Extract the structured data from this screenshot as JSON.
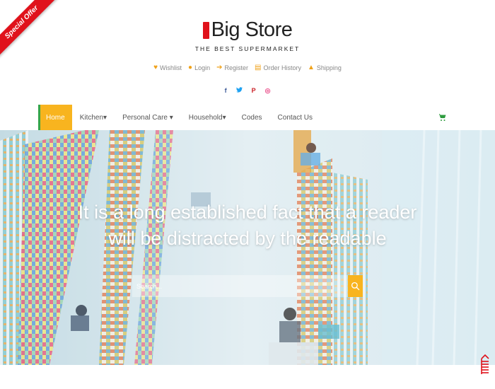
{
  "ribbon": {
    "label": "Special Offer"
  },
  "brand": {
    "name": "Big Store",
    "tagline": "THE BEST SUPERMARKET"
  },
  "top_links": [
    {
      "label": "Wishlist",
      "icon": "heart-icon"
    },
    {
      "label": "Login",
      "icon": "user-icon"
    },
    {
      "label": "Register",
      "icon": "arrow-right-icon"
    },
    {
      "label": "Order History",
      "icon": "file-icon"
    },
    {
      "label": "Shipping",
      "icon": "ship-icon"
    }
  ],
  "social": [
    {
      "icon": "facebook-icon",
      "glyph": "f",
      "color": "#3b5998"
    },
    {
      "icon": "twitter-icon",
      "glyph": "t",
      "color": "#1da1f2"
    },
    {
      "icon": "pinterest-icon",
      "glyph": "P",
      "color": "#cb2027"
    },
    {
      "icon": "dribbble-icon",
      "glyph": "◎",
      "color": "#ea4c89"
    }
  ],
  "nav": {
    "items": [
      {
        "label": "Home",
        "active": true
      },
      {
        "label": "Kitchen▾"
      },
      {
        "label": "Personal Care ▾"
      },
      {
        "label": "Household▾"
      },
      {
        "label": "Codes"
      },
      {
        "label": "Contact Us"
      }
    ]
  },
  "hero": {
    "title_line1": "It is a long established fact that a reader",
    "title_line2": "will be distracted by the readable",
    "search_placeholder": "Search..."
  },
  "colors": {
    "accent": "#f8b41f",
    "brand_red": "#e0121b",
    "green": "#35a54a"
  }
}
